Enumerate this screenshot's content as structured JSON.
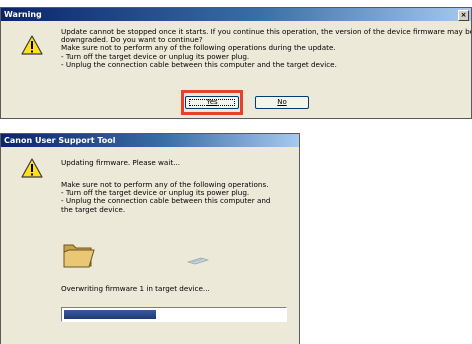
{
  "warning_dialog": {
    "title": "Warning",
    "message_lines": [
      "Update cannot be stopped once it starts. If you continue this operation, the version of the device firmware may be",
      "downgraded. Do you want to continue?",
      "Make sure not to perform any of the following operations during the update.",
      "- Turn off the target device or unplug its power plug.",
      "- Unplug the connection cable between this computer and the target device."
    ],
    "yes_label": "Yes",
    "no_label": "No",
    "highlight_color": "#e8402a"
  },
  "progress_dialog": {
    "title": "Canon User Support Tool",
    "heading": "Updating firmware. Please wait...",
    "instruction_lines": [
      "Make sure not to perform any of the following operations.",
      "- Turn off the target device or unplug its power plug.",
      "- Unplug the connection cable between this computer and",
      "the target device."
    ],
    "status": "Overwriting firmware 1 in target device...",
    "progress_fraction": 0.42
  },
  "icons": {
    "warning": "warning-icon",
    "folder": "folder-icon",
    "transfer": "data-transfer-icon"
  }
}
